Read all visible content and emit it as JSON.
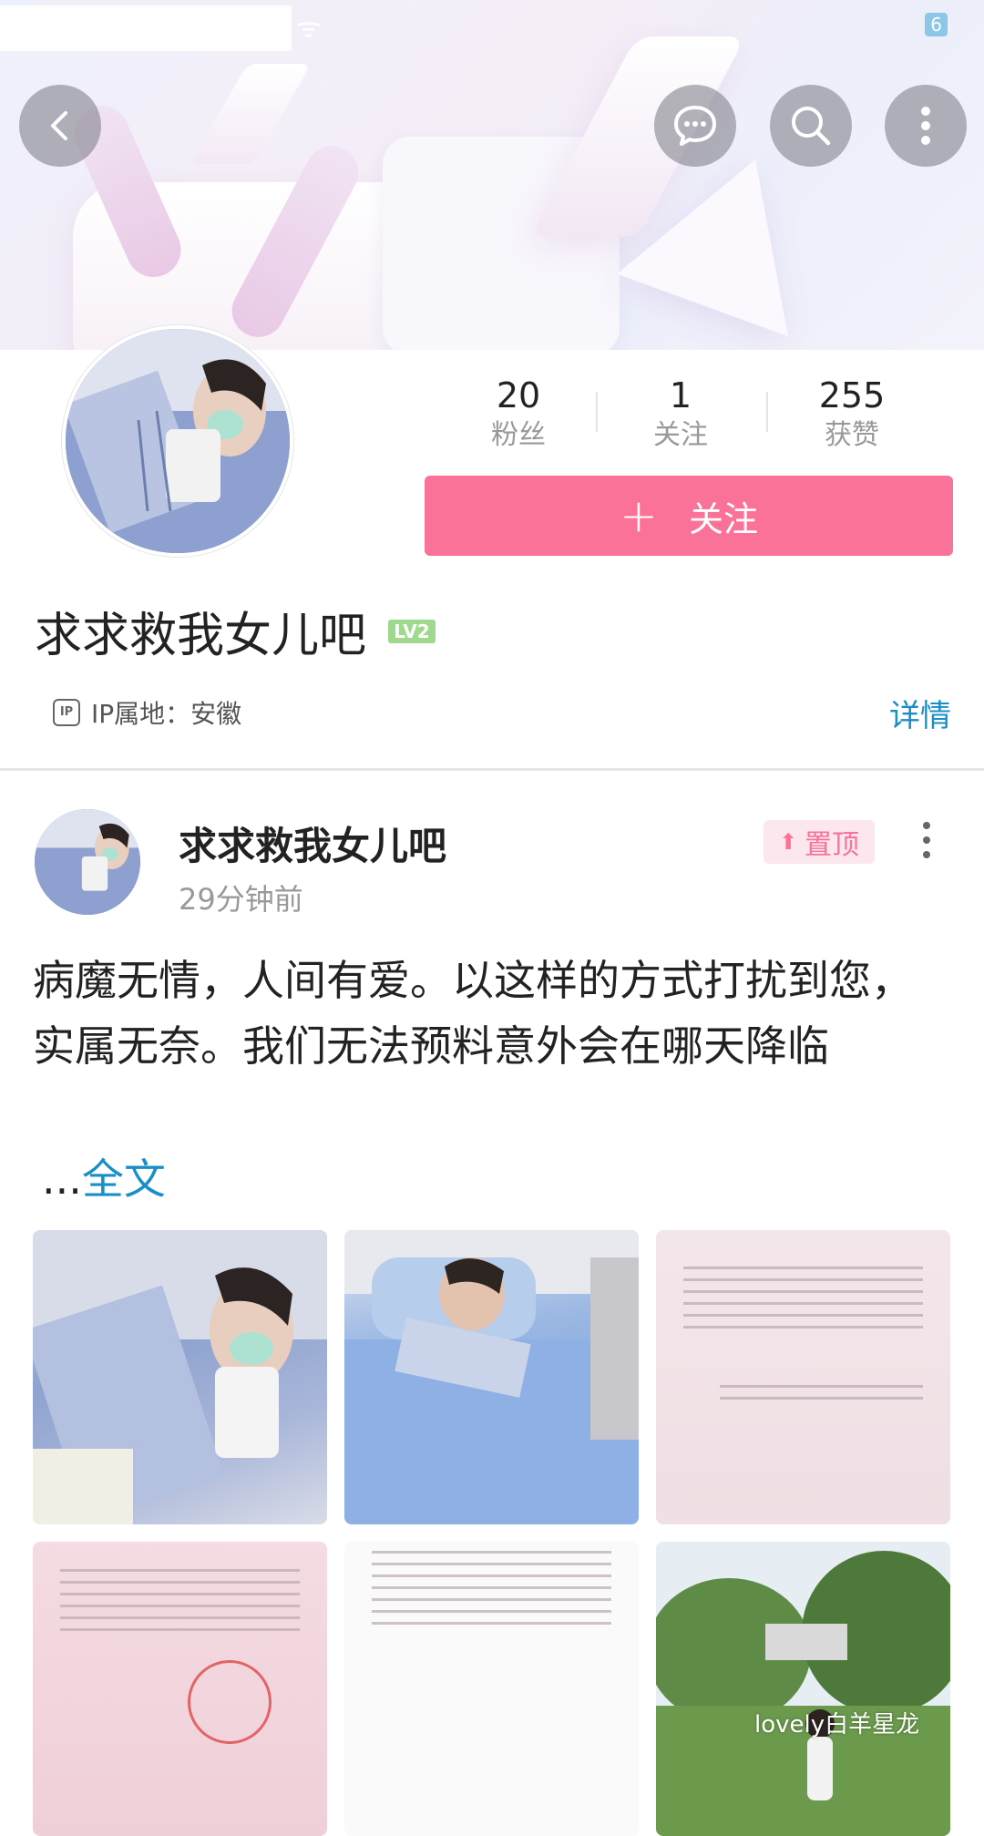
{
  "status_bar": {
    "battery": "6"
  },
  "header": {
    "icons": {
      "back": "back-arrow-icon",
      "message": "chat-bubble-icon",
      "search": "search-icon",
      "more": "more-vertical-icon"
    }
  },
  "profile": {
    "stats": [
      {
        "value": "20",
        "label": "粉丝"
      },
      {
        "value": "1",
        "label": "关注"
      },
      {
        "value": "255",
        "label": "获赞"
      }
    ],
    "follow_label": "关注",
    "username": "求求救我女儿吧",
    "level": "LV2",
    "ip_label": "IP属地：安徽",
    "detail_link": "详情"
  },
  "post": {
    "author": "求求救我女儿吧",
    "time": "29分钟前",
    "pin_label": "置顶",
    "text": "病魔无情，人间有爱。以这样的方式打扰到您，实属无奈。我们无法预料意外会在哪天降临",
    "ellipsis": "...",
    "full_text_link": "全文"
  },
  "watermark": "lovely白羊星龙",
  "colors": {
    "accent": "#fb7299",
    "link": "#1a8fc7",
    "level": "#9ed98d"
  }
}
